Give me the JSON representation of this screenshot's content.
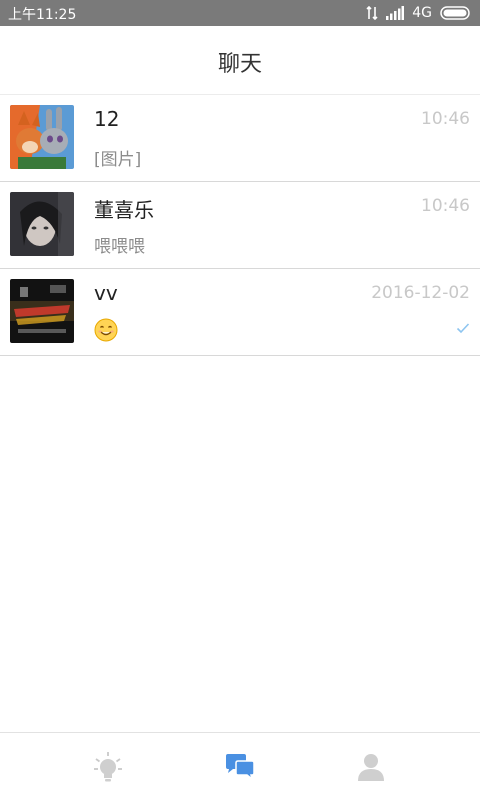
{
  "status_bar": {
    "time": "上午11:25",
    "network": "4G",
    "icons": [
      "data-transfer-icon",
      "signal-icon",
      "battery-icon"
    ]
  },
  "header": {
    "title": "聊天"
  },
  "chats": [
    {
      "name": "12",
      "time": "10:46",
      "preview": "[图片]",
      "avatar": "avatar-cartoon-fox-rabbit"
    },
    {
      "name": "董喜乐",
      "time": "10:46",
      "preview": "喂喂喂",
      "avatar": "avatar-dark-portrait"
    },
    {
      "name": "vv",
      "time": "2016-12-02",
      "preview_icon": "smile-emoji-icon",
      "status_icon": "check-icon",
      "avatar": "avatar-dark-poster"
    }
  ],
  "tabbar": {
    "tabs": [
      {
        "icon": "lightbulb-icon",
        "active": false
      },
      {
        "icon": "chat-bubbles-icon",
        "active": true
      },
      {
        "icon": "person-icon",
        "active": false
      }
    ]
  },
  "colors": {
    "status_bar_bg": "#7a7a7a",
    "accent": "#4a90e2",
    "time_text": "#c8c8c8",
    "preview_text": "#8c8c8c"
  }
}
